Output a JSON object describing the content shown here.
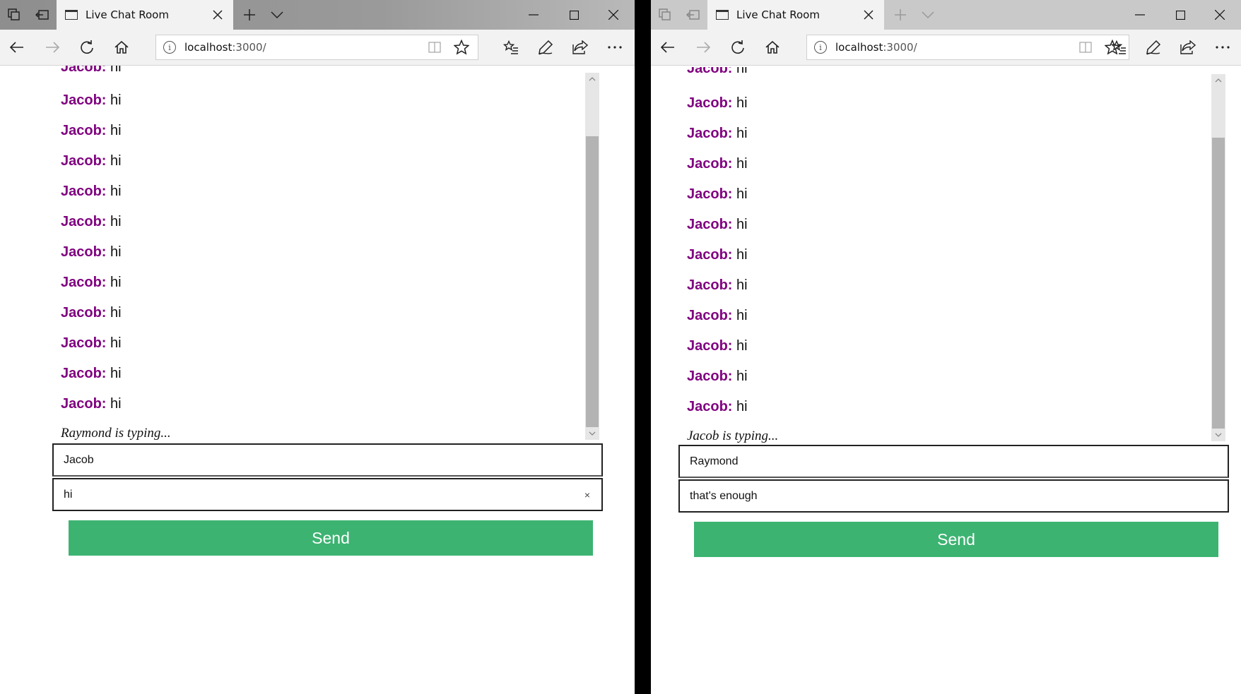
{
  "windows": [
    {
      "id": "left",
      "tab_title": "Live Chat Room",
      "url_host": "localhost",
      "url_rest": ":3000/",
      "partial_message": {
        "author": "Jacob:",
        "text": " hi"
      },
      "messages": [
        {
          "author": "Jacob:",
          "text": " hi"
        },
        {
          "author": "Jacob:",
          "text": " hi"
        },
        {
          "author": "Jacob:",
          "text": " hi"
        },
        {
          "author": "Jacob:",
          "text": " hi"
        },
        {
          "author": "Jacob:",
          "text": " hi"
        },
        {
          "author": "Jacob:",
          "text": " hi"
        },
        {
          "author": "Jacob:",
          "text": " hi"
        },
        {
          "author": "Jacob:",
          "text": " hi"
        },
        {
          "author": "Jacob:",
          "text": " hi"
        },
        {
          "author": "Jacob:",
          "text": " hi"
        },
        {
          "author": "Jacob:",
          "text": " hi"
        }
      ],
      "typing_indicator": "Raymond is typing...",
      "name_value": "Jacob",
      "message_value": "hi",
      "clear_glyph": "×",
      "send_label": "Send"
    },
    {
      "id": "right",
      "tab_title": "Live Chat Room",
      "url_host": "localhost",
      "url_rest": ":3000/",
      "partial_message": {
        "author": "Jacob:",
        "text": " hi"
      },
      "messages": [
        {
          "author": "Jacob:",
          "text": " hi"
        },
        {
          "author": "Jacob:",
          "text": " hi"
        },
        {
          "author": "Jacob:",
          "text": " hi"
        },
        {
          "author": "Jacob:",
          "text": " hi"
        },
        {
          "author": "Jacob:",
          "text": " hi"
        },
        {
          "author": "Jacob:",
          "text": " hi"
        },
        {
          "author": "Jacob:",
          "text": " hi"
        },
        {
          "author": "Jacob:",
          "text": " hi"
        },
        {
          "author": "Jacob:",
          "text": " hi"
        },
        {
          "author": "Jacob:",
          "text": " hi"
        },
        {
          "author": "Jacob:",
          "text": " hi"
        }
      ],
      "typing_indicator": "Jacob is typing...",
      "name_value": "Raymond",
      "message_value": "that's enough",
      "send_label": "Send"
    }
  ],
  "icons": {
    "tab_actions": "tab-actions-icon",
    "set_aside": "set-aside-tabs-icon",
    "new_tab": "plus-icon",
    "tab_list": "chevron-down-icon",
    "minimize": "minimize-icon",
    "maximize": "maximize-icon",
    "close": "close-icon",
    "back": "back-arrow-icon",
    "forward": "forward-arrow-icon",
    "refresh": "refresh-icon",
    "home": "home-icon",
    "reading_view": "reading-view-icon",
    "favorite": "star-icon",
    "favorites_hub": "favorites-list-icon",
    "web_note": "pen-icon",
    "share": "share-icon",
    "more": "more-icon"
  },
  "colors": {
    "author": "#800080",
    "send_button": "#3cb371"
  }
}
